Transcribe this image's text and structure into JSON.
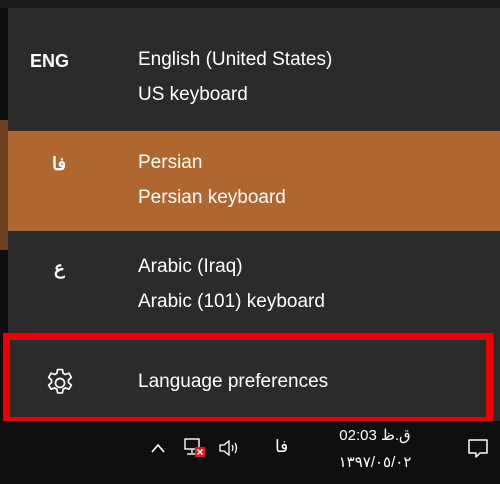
{
  "languages": [
    {
      "code": "ENG",
      "name": "English (United States)",
      "keyboard": "US keyboard",
      "selected": false
    },
    {
      "code": "فا",
      "name": "Persian",
      "keyboard": "Persian keyboard",
      "selected": true
    },
    {
      "code": "ع",
      "name": "Arabic (Iraq)",
      "keyboard": "Arabic (101) keyboard",
      "selected": false
    }
  ],
  "preferences": {
    "label": "Language preferences",
    "icon": "gear-icon"
  },
  "taskbar": {
    "input_indicator": "فا",
    "time": "02:03 ق.ظ",
    "date": "١٣٩٧/٠٥/٠٢",
    "icons": [
      "chevron-up-icon",
      "network-disconnected-icon",
      "volume-icon",
      "notification-icon"
    ]
  },
  "colors": {
    "flyout_bg": "#2b2b2b",
    "selected_bg": "#b0662f",
    "highlight_border": "#ee0000",
    "taskbar_bg": "#0f0f0f"
  }
}
